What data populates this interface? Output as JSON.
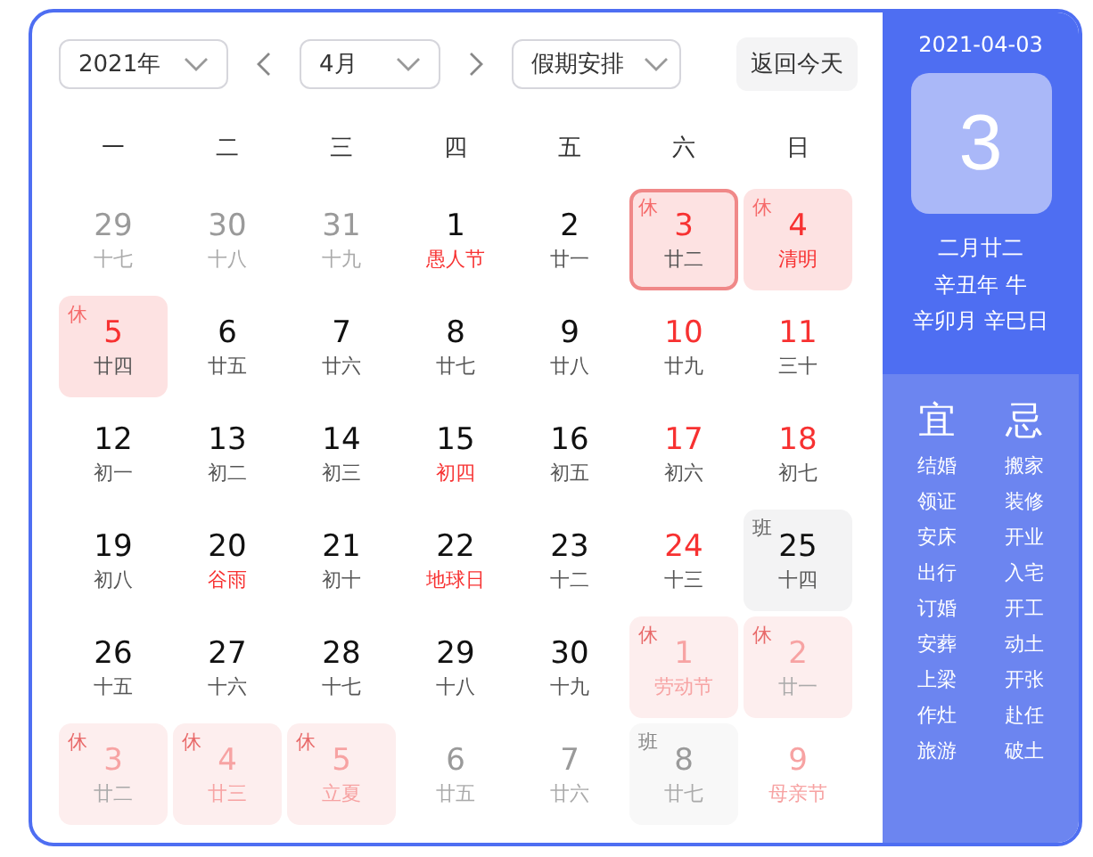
{
  "toolbar": {
    "year": "2021年",
    "month": "4月",
    "holiday": "假期安排",
    "today_button": "返回今天"
  },
  "weekdays": [
    "一",
    "二",
    "三",
    "四",
    "五",
    "六",
    "日"
  ],
  "weeks": [
    [
      {
        "day": "29",
        "lunar": "十七",
        "in_month": false,
        "red": false,
        "festival": false,
        "selected": false
      },
      {
        "day": "30",
        "lunar": "十八",
        "in_month": false,
        "red": false,
        "festival": false,
        "selected": false
      },
      {
        "day": "31",
        "lunar": "十九",
        "in_month": false,
        "red": false,
        "festival": false,
        "selected": false
      },
      {
        "day": "1",
        "lunar": "愚人节",
        "in_month": true,
        "red": false,
        "festival": true,
        "selected": false
      },
      {
        "day": "2",
        "lunar": "廿一",
        "in_month": true,
        "red": false,
        "festival": false,
        "selected": false
      },
      {
        "day": "3",
        "lunar": "廿二",
        "in_month": true,
        "red": true,
        "festival": false,
        "selected": true,
        "badge": {
          "text": "休",
          "kind": "rest"
        }
      },
      {
        "day": "4",
        "lunar": "清明",
        "in_month": true,
        "red": true,
        "festival": true,
        "selected": false,
        "badge": {
          "text": "休",
          "kind": "rest"
        }
      }
    ],
    [
      {
        "day": "5",
        "lunar": "廿四",
        "in_month": true,
        "red": true,
        "festival": false,
        "selected": false,
        "badge": {
          "text": "休",
          "kind": "rest"
        }
      },
      {
        "day": "6",
        "lunar": "廿五",
        "in_month": true,
        "red": false,
        "festival": false,
        "selected": false
      },
      {
        "day": "7",
        "lunar": "廿六",
        "in_month": true,
        "red": false,
        "festival": false,
        "selected": false
      },
      {
        "day": "8",
        "lunar": "廿七",
        "in_month": true,
        "red": false,
        "festival": false,
        "selected": false
      },
      {
        "day": "9",
        "lunar": "廿八",
        "in_month": true,
        "red": false,
        "festival": false,
        "selected": false
      },
      {
        "day": "10",
        "lunar": "廿九",
        "in_month": true,
        "red": true,
        "festival": false,
        "selected": false
      },
      {
        "day": "11",
        "lunar": "三十",
        "in_month": true,
        "red": true,
        "festival": false,
        "selected": false
      }
    ],
    [
      {
        "day": "12",
        "lunar": "初一",
        "in_month": true,
        "red": false,
        "festival": false,
        "selected": false
      },
      {
        "day": "13",
        "lunar": "初二",
        "in_month": true,
        "red": false,
        "festival": false,
        "selected": false
      },
      {
        "day": "14",
        "lunar": "初三",
        "in_month": true,
        "red": false,
        "festival": false,
        "selected": false
      },
      {
        "day": "15",
        "lunar": "初四",
        "in_month": true,
        "red": false,
        "festival": true,
        "selected": false
      },
      {
        "day": "16",
        "lunar": "初五",
        "in_month": true,
        "red": false,
        "festival": false,
        "selected": false
      },
      {
        "day": "17",
        "lunar": "初六",
        "in_month": true,
        "red": true,
        "festival": false,
        "selected": false
      },
      {
        "day": "18",
        "lunar": "初七",
        "in_month": true,
        "red": true,
        "festival": false,
        "selected": false
      }
    ],
    [
      {
        "day": "19",
        "lunar": "初八",
        "in_month": true,
        "red": false,
        "festival": false,
        "selected": false
      },
      {
        "day": "20",
        "lunar": "谷雨",
        "in_month": true,
        "red": false,
        "festival": true,
        "selected": false
      },
      {
        "day": "21",
        "lunar": "初十",
        "in_month": true,
        "red": false,
        "festival": false,
        "selected": false
      },
      {
        "day": "22",
        "lunar": "地球日",
        "in_month": true,
        "red": false,
        "festival": true,
        "selected": false
      },
      {
        "day": "23",
        "lunar": "十二",
        "in_month": true,
        "red": false,
        "festival": false,
        "selected": false
      },
      {
        "day": "24",
        "lunar": "十三",
        "in_month": true,
        "red": true,
        "festival": false,
        "selected": false
      },
      {
        "day": "25",
        "lunar": "十四",
        "in_month": true,
        "red": false,
        "festival": false,
        "selected": false,
        "badge": {
          "text": "班",
          "kind": "work"
        }
      }
    ],
    [
      {
        "day": "26",
        "lunar": "十五",
        "in_month": true,
        "red": false,
        "festival": false,
        "selected": false
      },
      {
        "day": "27",
        "lunar": "十六",
        "in_month": true,
        "red": false,
        "festival": false,
        "selected": false
      },
      {
        "day": "28",
        "lunar": "十七",
        "in_month": true,
        "red": false,
        "festival": false,
        "selected": false
      },
      {
        "day": "29",
        "lunar": "十八",
        "in_month": true,
        "red": false,
        "festival": false,
        "selected": false
      },
      {
        "day": "30",
        "lunar": "十九",
        "in_month": true,
        "red": false,
        "festival": false,
        "selected": false
      },
      {
        "day": "1",
        "lunar": "劳动节",
        "in_month": false,
        "red": true,
        "festival": true,
        "selected": false,
        "badge": {
          "text": "休",
          "kind": "rest"
        }
      },
      {
        "day": "2",
        "lunar": "廿一",
        "in_month": false,
        "red": true,
        "festival": false,
        "selected": false,
        "badge": {
          "text": "休",
          "kind": "rest"
        }
      }
    ],
    [
      {
        "day": "3",
        "lunar": "廿二",
        "in_month": false,
        "red": true,
        "festival": false,
        "selected": false,
        "badge": {
          "text": "休",
          "kind": "rest"
        }
      },
      {
        "day": "4",
        "lunar": "廿三",
        "in_month": false,
        "red": true,
        "festival": true,
        "selected": false,
        "badge": {
          "text": "休",
          "kind": "rest"
        }
      },
      {
        "day": "5",
        "lunar": "立夏",
        "in_month": false,
        "red": true,
        "festival": true,
        "selected": false,
        "badge": {
          "text": "休",
          "kind": "rest"
        }
      },
      {
        "day": "6",
        "lunar": "廿五",
        "in_month": false,
        "red": false,
        "festival": false,
        "selected": false
      },
      {
        "day": "7",
        "lunar": "廿六",
        "in_month": false,
        "red": false,
        "festival": false,
        "selected": false
      },
      {
        "day": "8",
        "lunar": "廿七",
        "in_month": false,
        "red": false,
        "festival": false,
        "selected": false,
        "badge": {
          "text": "班",
          "kind": "work"
        }
      },
      {
        "day": "9",
        "lunar": "母亲节",
        "in_month": false,
        "red": true,
        "festival": true,
        "selected": false
      }
    ]
  ],
  "detail": {
    "date": "2021-04-03",
    "day": "3",
    "lunar_lines": [
      "二月廿二",
      "辛丑年 牛",
      "辛卯月 辛巳日"
    ]
  },
  "almanac": {
    "good": {
      "title": "宜",
      "items": [
        "结婚",
        "领证",
        "安床",
        "出行",
        "订婚",
        "安葬",
        "上梁",
        "作灶",
        "旅游"
      ]
    },
    "bad": {
      "title": "忌",
      "items": [
        "搬家",
        "装修",
        "开业",
        "入宅",
        "开工",
        "动土",
        "开张",
        "赴任",
        "破土"
      ]
    }
  }
}
